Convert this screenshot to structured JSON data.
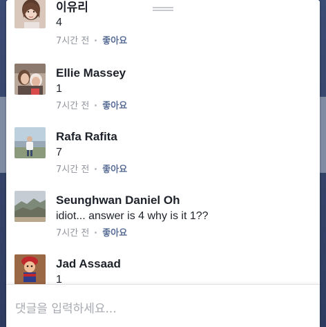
{
  "colors": {
    "text": "#1d2129",
    "meta": "#90949c",
    "like": "#5b6f97",
    "placeholder": "#a7aab0",
    "backdrop": "#33456b"
  },
  "comments": [
    {
      "name": "이유리",
      "text": "4",
      "time": "7시간 전",
      "like_label": "좋아요",
      "avatar": "avatar-photo-woman"
    },
    {
      "name": "Ellie Massey",
      "text": "1",
      "time": "7시간 전",
      "like_label": "좋아요",
      "avatar": "avatar-photo-two-people"
    },
    {
      "name": "Rafa Rafita",
      "text": "7",
      "time": "7시간 전",
      "like_label": "좋아요",
      "avatar": "avatar-photo-person-outdoor"
    },
    {
      "name": "Seunghwan Daniel Oh",
      "text": "idiot...  answer is  4 why is it 1??",
      "time": "7시간 전",
      "like_label": "좋아요",
      "avatar": "avatar-photo-landscape"
    },
    {
      "name": "Jad Assaad",
      "text": "1",
      "time": "",
      "like_label": "",
      "avatar": "avatar-cartoon-character"
    }
  ],
  "composer": {
    "placeholder": "댓글을 입력하세요..."
  }
}
